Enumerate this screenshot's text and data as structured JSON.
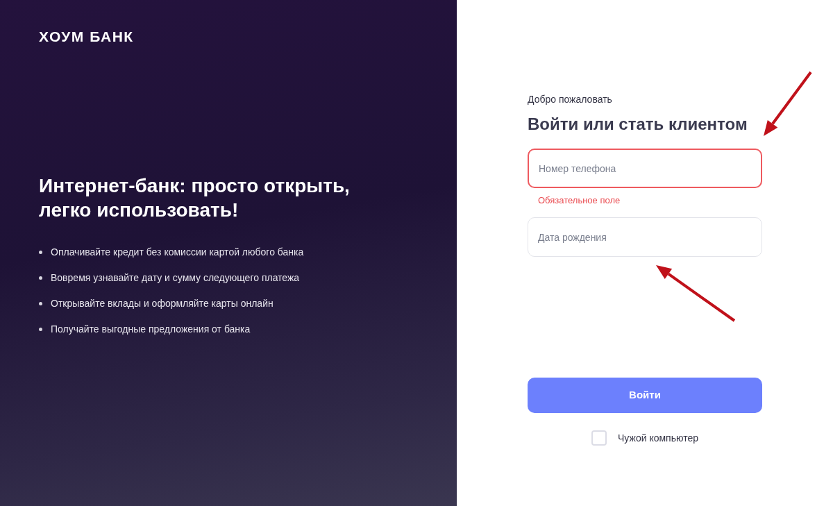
{
  "brand": "ХОУМ БАНК",
  "headline": "Интернет-банк: просто открыть, легко использовать!",
  "features": [
    "Оплачивайте кредит без комиссии картой любого банка",
    "Вовремя узнавайте дату и сумму следующего платежа",
    "Открывайте вклады и оформляйте карты онлайн",
    "Получайте выгодные предложения от банка"
  ],
  "form": {
    "greeting": "Добро пожаловать",
    "title": "Войти или стать клиентом",
    "fields": [
      {
        "placeholder": "Номер телефона",
        "invalid": true,
        "error": "Обязательное поле"
      },
      {
        "placeholder": "Дата рождения",
        "invalid": false
      }
    ],
    "submit": "Войти",
    "checkbox": {
      "label": "Чужой компьютер",
      "checked": false
    }
  }
}
